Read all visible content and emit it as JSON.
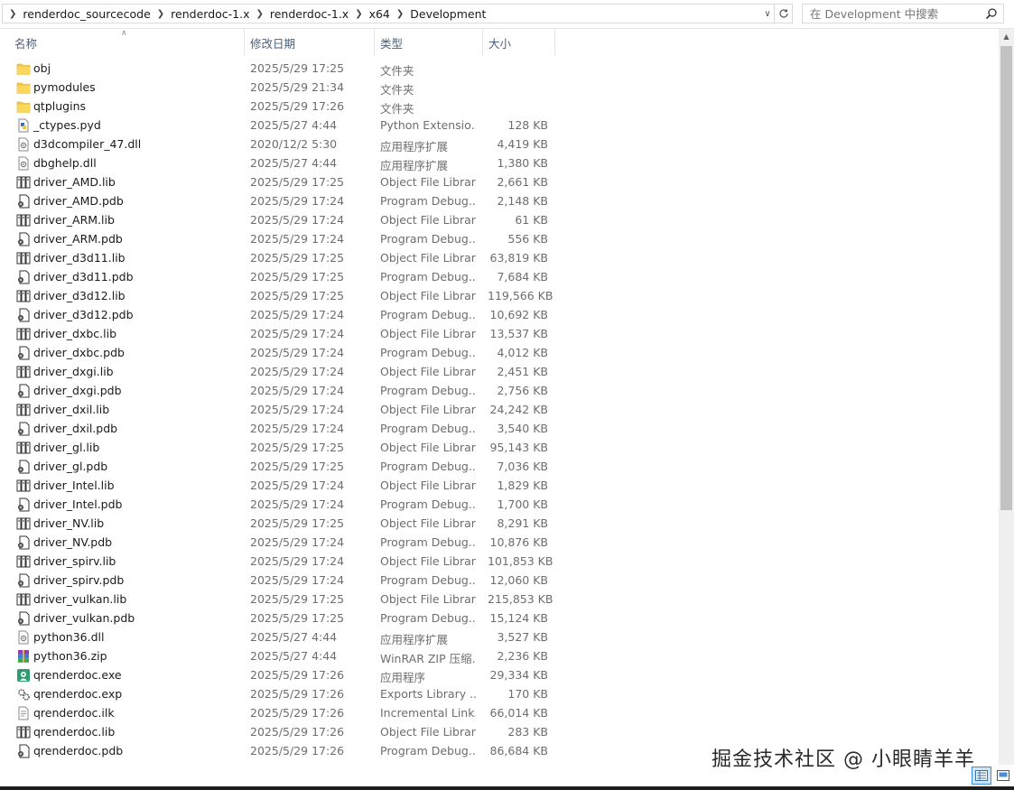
{
  "address_bar": {
    "crumbs": [
      "renderdoc_sourcecode",
      "renderdoc-1.x",
      "renderdoc-1.x",
      "x64",
      "Development"
    ],
    "search_placeholder": "在 Development 中搜索"
  },
  "columns": {
    "name": "名称",
    "date": "修改日期",
    "type": "类型",
    "size": "大小"
  },
  "files": [
    {
      "name": "obj",
      "date": "2025/5/29 17:25",
      "type": "文件夹",
      "size": "",
      "icon": "folder-icon"
    },
    {
      "name": "pymodules",
      "date": "2025/5/29 21:34",
      "type": "文件夹",
      "size": "",
      "icon": "folder-icon"
    },
    {
      "name": "qtplugins",
      "date": "2025/5/29 17:26",
      "type": "文件夹",
      "size": "",
      "icon": "folder-icon"
    },
    {
      "name": "_ctypes.pyd",
      "date": "2025/5/27 4:44",
      "type": "Python Extensio...",
      "size": "128 KB",
      "icon": "python-file-icon"
    },
    {
      "name": "d3dcompiler_47.dll",
      "date": "2020/12/2 5:30",
      "type": "应用程序扩展",
      "size": "4,419 KB",
      "icon": "dll-file-icon"
    },
    {
      "name": "dbghelp.dll",
      "date": "2025/5/27 4:44",
      "type": "应用程序扩展",
      "size": "1,380 KB",
      "icon": "dll-file-icon"
    },
    {
      "name": "driver_AMD.lib",
      "date": "2025/5/29 17:25",
      "type": "Object File Library",
      "size": "2,661 KB",
      "icon": "lib-file-icon"
    },
    {
      "name": "driver_AMD.pdb",
      "date": "2025/5/29 17:24",
      "type": "Program Debug...",
      "size": "2,148 KB",
      "icon": "pdb-file-icon"
    },
    {
      "name": "driver_ARM.lib",
      "date": "2025/5/29 17:24",
      "type": "Object File Library",
      "size": "61 KB",
      "icon": "lib-file-icon"
    },
    {
      "name": "driver_ARM.pdb",
      "date": "2025/5/29 17:24",
      "type": "Program Debug...",
      "size": "556 KB",
      "icon": "pdb-file-icon"
    },
    {
      "name": "driver_d3d11.lib",
      "date": "2025/5/29 17:25",
      "type": "Object File Library",
      "size": "63,819 KB",
      "icon": "lib-file-icon"
    },
    {
      "name": "driver_d3d11.pdb",
      "date": "2025/5/29 17:25",
      "type": "Program Debug...",
      "size": "7,684 KB",
      "icon": "pdb-file-icon"
    },
    {
      "name": "driver_d3d12.lib",
      "date": "2025/5/29 17:25",
      "type": "Object File Library",
      "size": "119,566 KB",
      "icon": "lib-file-icon"
    },
    {
      "name": "driver_d3d12.pdb",
      "date": "2025/5/29 17:24",
      "type": "Program Debug...",
      "size": "10,692 KB",
      "icon": "pdb-file-icon"
    },
    {
      "name": "driver_dxbc.lib",
      "date": "2025/5/29 17:24",
      "type": "Object File Library",
      "size": "13,537 KB",
      "icon": "lib-file-icon"
    },
    {
      "name": "driver_dxbc.pdb",
      "date": "2025/5/29 17:24",
      "type": "Program Debug...",
      "size": "4,012 KB",
      "icon": "pdb-file-icon"
    },
    {
      "name": "driver_dxgi.lib",
      "date": "2025/5/29 17:24",
      "type": "Object File Library",
      "size": "2,451 KB",
      "icon": "lib-file-icon"
    },
    {
      "name": "driver_dxgi.pdb",
      "date": "2025/5/29 17:24",
      "type": "Program Debug...",
      "size": "2,756 KB",
      "icon": "pdb-file-icon"
    },
    {
      "name": "driver_dxil.lib",
      "date": "2025/5/29 17:24",
      "type": "Object File Library",
      "size": "24,242 KB",
      "icon": "lib-file-icon"
    },
    {
      "name": "driver_dxil.pdb",
      "date": "2025/5/29 17:24",
      "type": "Program Debug...",
      "size": "3,540 KB",
      "icon": "pdb-file-icon"
    },
    {
      "name": "driver_gl.lib",
      "date": "2025/5/29 17:25",
      "type": "Object File Library",
      "size": "95,143 KB",
      "icon": "lib-file-icon"
    },
    {
      "name": "driver_gl.pdb",
      "date": "2025/5/29 17:25",
      "type": "Program Debug...",
      "size": "7,036 KB",
      "icon": "pdb-file-icon"
    },
    {
      "name": "driver_Intel.lib",
      "date": "2025/5/29 17:24",
      "type": "Object File Library",
      "size": "1,829 KB",
      "icon": "lib-file-icon"
    },
    {
      "name": "driver_Intel.pdb",
      "date": "2025/5/29 17:24",
      "type": "Program Debug...",
      "size": "1,700 KB",
      "icon": "pdb-file-icon"
    },
    {
      "name": "driver_NV.lib",
      "date": "2025/5/29 17:25",
      "type": "Object File Library",
      "size": "8,291 KB",
      "icon": "lib-file-icon"
    },
    {
      "name": "driver_NV.pdb",
      "date": "2025/5/29 17:24",
      "type": "Program Debug...",
      "size": "10,876 KB",
      "icon": "pdb-file-icon"
    },
    {
      "name": "driver_spirv.lib",
      "date": "2025/5/29 17:24",
      "type": "Object File Library",
      "size": "101,853 KB",
      "icon": "lib-file-icon"
    },
    {
      "name": "driver_spirv.pdb",
      "date": "2025/5/29 17:24",
      "type": "Program Debug...",
      "size": "12,060 KB",
      "icon": "pdb-file-icon"
    },
    {
      "name": "driver_vulkan.lib",
      "date": "2025/5/29 17:25",
      "type": "Object File Library",
      "size": "215,853 KB",
      "icon": "lib-file-icon"
    },
    {
      "name": "driver_vulkan.pdb",
      "date": "2025/5/29 17:25",
      "type": "Program Debug...",
      "size": "15,124 KB",
      "icon": "pdb-file-icon"
    },
    {
      "name": "python36.dll",
      "date": "2025/5/27 4:44",
      "type": "应用程序扩展",
      "size": "3,527 KB",
      "icon": "dll-file-icon"
    },
    {
      "name": "python36.zip",
      "date": "2025/5/27 4:44",
      "type": "WinRAR ZIP 压缩...",
      "size": "2,236 KB",
      "icon": "winrar-archive-icon"
    },
    {
      "name": "qrenderdoc.exe",
      "date": "2025/5/29 17:26",
      "type": "应用程序",
      "size": "29,334 KB",
      "icon": "renderdoc-app-icon"
    },
    {
      "name": "qrenderdoc.exp",
      "date": "2025/5/29 17:26",
      "type": "Exports Library ...",
      "size": "170 KB",
      "icon": "exp-file-icon"
    },
    {
      "name": "qrenderdoc.ilk",
      "date": "2025/5/29 17:26",
      "type": "Incremental Link...",
      "size": "66,014 KB",
      "icon": "ilk-file-icon"
    },
    {
      "name": "qrenderdoc.lib",
      "date": "2025/5/29 17:26",
      "type": "Object File Library",
      "size": "283 KB",
      "icon": "lib-file-icon"
    },
    {
      "name": "qrenderdoc.pdb",
      "date": "2025/5/29 17:26",
      "type": "Program Debug...",
      "size": "86,684 KB",
      "icon": "pdb-file-icon"
    }
  ],
  "watermark": "掘金技术社区 @ 小眼睛羊羊",
  "colors": {
    "header_text": "#4c607a",
    "secondary_text": "#6d6d6d",
    "folder": "#f5c945",
    "selected_view": "#cce4f7"
  }
}
